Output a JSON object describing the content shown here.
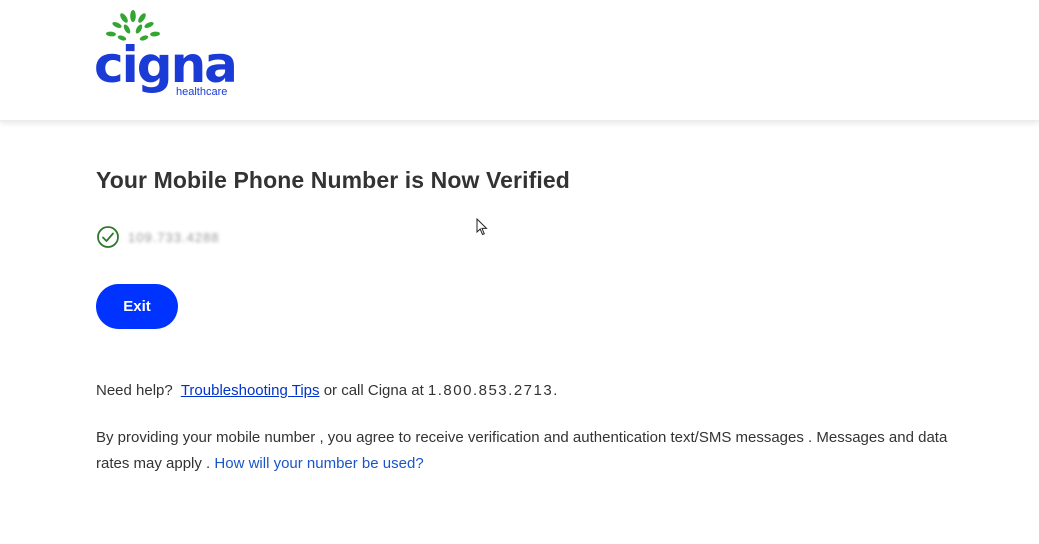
{
  "header": {
    "logo_text": "cigna",
    "logo_subtext": "healthcare"
  },
  "main": {
    "title": "Your Mobile Phone Number is Now Verified",
    "masked_phone": "109.733.4288",
    "exit_label": "Exit"
  },
  "help": {
    "prefix": "Need help?",
    "tips_link": "Troubleshooting Tips",
    "call_text": "or call Cigna at",
    "phone_number": "1.800.853.2713",
    "suffix": "."
  },
  "consent": {
    "text": "By providing your mobile number ,  you agree to receive verification and authentication text/SMS messages . Messages and data rates may apply . ",
    "link": "How will your number be used?"
  },
  "colors": {
    "brand_blue": "#0033ff",
    "logo_green": "#33a532",
    "check_green": "#2f7a2a"
  }
}
